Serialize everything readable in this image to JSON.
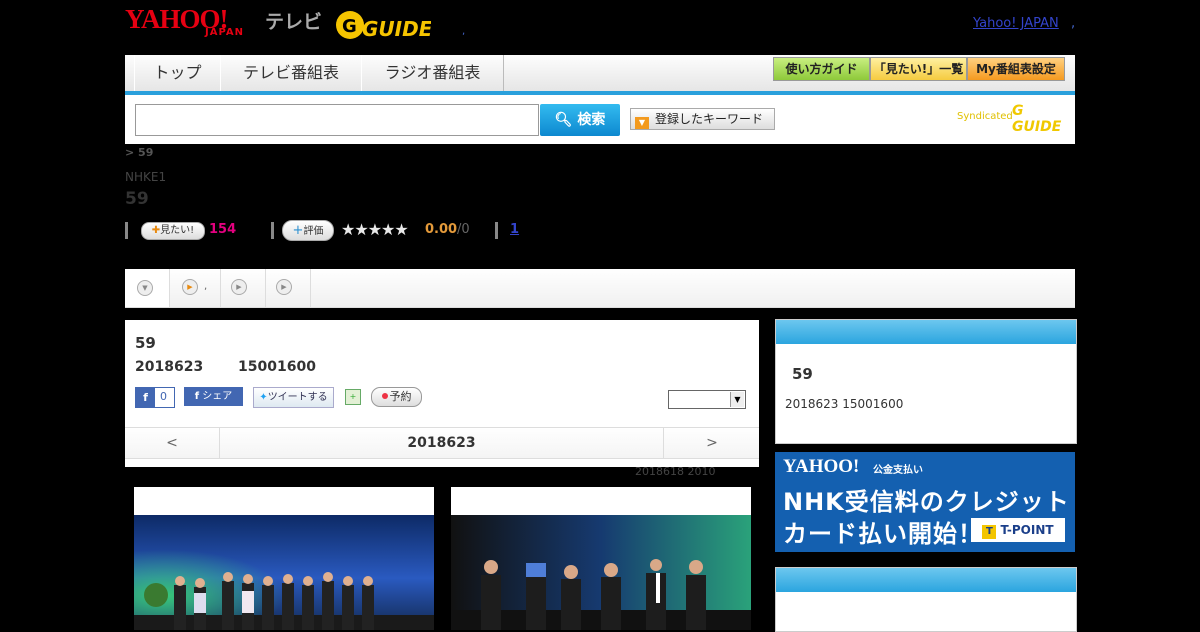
{
  "header": {
    "yahoo_logo": "YAHOO!",
    "japan_logo": "JAPAN",
    "tv_label": "テレビ",
    "gguide_logo": "G GUIDE",
    "dot_left": ",",
    "yahoo_japan_link": "Yahoo! JAPAN",
    "dot_right": ","
  },
  "nav": {
    "tabs": [
      "トップ",
      "テレビ番組表",
      "ラジオ番組表"
    ],
    "guide_buttons": [
      "使い方ガイド",
      "「見たい!」一覧",
      "My番組表設定"
    ]
  },
  "search": {
    "input_value": "",
    "select_value": "",
    "button_label": "検索",
    "keyword_button": "登録したキーワード",
    "syndicated": "Syndicated",
    "syndicated_logo": "G GUIDE"
  },
  "program": {
    "breadcrumb": "> 59",
    "channel": "NHKE1",
    "title": "59",
    "mitai_label": "見たい!",
    "mitai_count": "154",
    "eval_label": "評価",
    "stars": "★★★★★",
    "score": "0.00",
    "score_count": "/0",
    "related_link": "1"
  },
  "tabs_strip": {
    "tab2_label": ","
  },
  "detail": {
    "title": "59",
    "date": "2018623",
    "time": "15001600",
    "fb_like_count": "0",
    "fb_share": "シェア",
    "tweet": "ツイートする",
    "reserve": "予約",
    "select_value": "",
    "prev": "<",
    "nav_date": "2018623",
    "next": ">",
    "footnote": "2018618 2010"
  },
  "sidebar": {
    "title": "59",
    "datetime": "2018623 15001600"
  },
  "ad": {
    "yahoo": "YAHOO!",
    "small_label": "公金支払い",
    "line1": "NHK受信料のクレジット",
    "line2": "カード払い開始！",
    "tpoint": "T-POINT"
  }
}
